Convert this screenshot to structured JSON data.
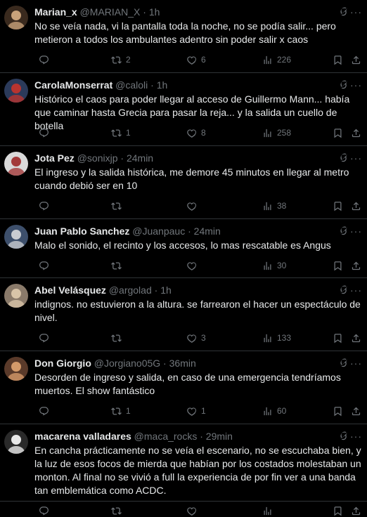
{
  "tweets": [
    {
      "name": "Marian_x",
      "handle": "@MARIAN_X",
      "time": "1h",
      "text": "No se veía nada, vi la pantalla toda la noche, no se podía salir... pero metieron a todos los ambulantes adentro sin poder salir x caos",
      "replies": "",
      "retweets": "2",
      "likes": "6",
      "views": "226",
      "avatar_colors": [
        "#3a2a1e",
        "#c9a27a"
      ]
    },
    {
      "name": "CarolaMonserrat",
      "handle": "@caloli",
      "time": "1h",
      "text": "Histórico el caos para poder llegar al acceso de Guillermo Mann... había que caminar hasta Grecia para pasar la reja... y la salida un cuello de botella",
      "replies": "",
      "retweets": "1",
      "likes": "8",
      "views": "258",
      "avatar_colors": [
        "#2b3a5a",
        "#b8342f"
      ]
    },
    {
      "name": "Jota Pez",
      "handle": "@sonixjp",
      "time": "24min",
      "text": "El ingreso y la salida histórica, me demore 45 minutos en llegar al metro cuando debió ser en 10",
      "replies": "",
      "retweets": "",
      "likes": "",
      "views": "38",
      "avatar_colors": [
        "#d9d9d9",
        "#a33a3a"
      ]
    },
    {
      "name": "Juan Pablo Sanchez",
      "handle": "@Juanpauc",
      "time": "24min",
      "text": "Malo el sonido, el recinto y los accesos, lo mas rescatable es Angus",
      "replies": "",
      "retweets": "",
      "likes": "",
      "views": "30",
      "avatar_colors": [
        "#3d4f6b",
        "#c9ccd1"
      ]
    },
    {
      "name": "Abel Velásquez",
      "handle": "@argolad",
      "time": "1h",
      "text": "indignos. no estuvieron a la altura. se farrearon el hacer un espectáculo de nivel.",
      "replies": "",
      "retweets": "",
      "likes": "3",
      "views": "133",
      "avatar_colors": [
        "#8a7a6a",
        "#d8c4a8"
      ]
    },
    {
      "name": "Don Giorgio",
      "handle": "@Jorgiano05G",
      "time": "36min",
      "text": "Desorden de ingreso y salida, en caso de una emergencia tendríamos muertos. El show fantástico",
      "replies": "",
      "retweets": "1",
      "likes": "1",
      "views": "60",
      "avatar_colors": [
        "#5a3a2a",
        "#d49a6a"
      ]
    },
    {
      "name": "macarena valladares",
      "handle": "@maca_rocks",
      "time": "29min",
      "text": "En cancha prácticamente no se veía el escenario, no se escuchaba bien, y la luz de esos focos de mierda que habían por los costados molestaban un monton. Al final no se vivió a full la experiencia de por fin ver a una banda tan emblemática como ACDC.",
      "replies": "",
      "retweets": "",
      "likes": "",
      "views": "",
      "avatar_colors": [
        "#2a2a2a",
        "#e8e8e8"
      ]
    }
  ],
  "icons": {
    "reply": "reply-icon",
    "retweet": "retweet-icon",
    "like": "like-icon",
    "views": "views-icon",
    "bookmark": "bookmark-icon",
    "share": "share-icon",
    "grok": "grok-icon",
    "more": "more-icon"
  },
  "colors": {
    "background": "#000000",
    "text": "#e7e9ea",
    "secondary": "#71767b",
    "divider": "#2f3336"
  }
}
